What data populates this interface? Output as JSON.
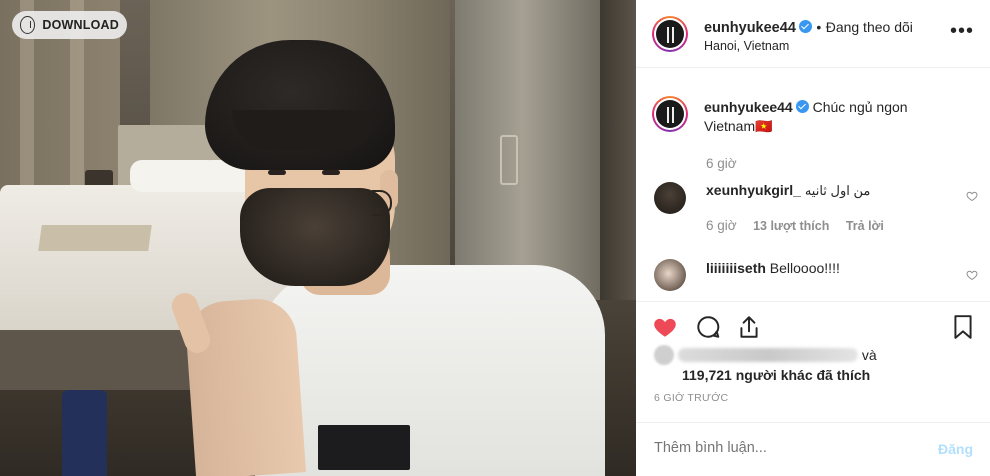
{
  "download": {
    "label": "DOWNLOAD"
  },
  "header": {
    "username": "eunhyukee44",
    "separator": "•",
    "follow_status": "Đang theo dõi",
    "location": "Hanoi, Vietnam",
    "more_icon": "more-dots-icon"
  },
  "caption": {
    "username": "eunhyukee44",
    "text_line1": "Chúc ngủ ngon",
    "text_line2": "Vietnam🇻🇳",
    "time": "6 giờ"
  },
  "comments": [
    {
      "username": "xeunhyukgirl_",
      "text": "من اول ثانيه",
      "time": "6 giờ",
      "likes": "13 lượt thích",
      "reply": "Trả lời"
    },
    {
      "username": "liiiiiiiseth",
      "text": "Belloooo!!!!"
    }
  ],
  "actions": {
    "icons": [
      "heart-filled-icon",
      "comment-icon",
      "share-icon",
      "bookmark-icon"
    ],
    "heart_color": "#ed4956"
  },
  "likes": {
    "and": "và",
    "count_text": "119,721 người khác đã thích"
  },
  "timestamp": "6 GIỜ TRƯỚC",
  "comment_box": {
    "placeholder": "Thêm bình luận...",
    "post_label": "Đăng"
  }
}
